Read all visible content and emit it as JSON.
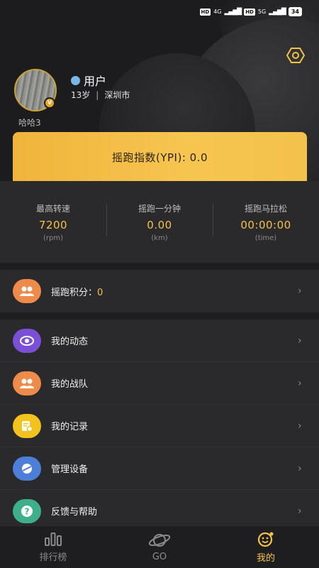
{
  "status_bar": {
    "net1_tag": "HD",
    "net1": "4G",
    "net2_tag": "HD",
    "net2": "5G",
    "battery": "34"
  },
  "profile": {
    "name": "用户",
    "age": "13岁",
    "city": "深圳市",
    "nickname": "哈哈3"
  },
  "ypi": {
    "label": "摇跑指数(YPI): 0.0"
  },
  "stats": [
    {
      "label": "最高转速",
      "value": "7200",
      "unit": "(rpm)"
    },
    {
      "label": "摇跑一分钟",
      "value": "0.00",
      "unit": "(km)"
    },
    {
      "label": "摇跑马拉松",
      "value": "00:00:00",
      "unit": "(time)"
    }
  ],
  "score": {
    "label": "摇跑积分：",
    "value": "0",
    "icon": "team-icon"
  },
  "menu": [
    {
      "label": "我的动态",
      "icon": "eye-icon",
      "color": "#7b4fd6"
    },
    {
      "label": "我的战队",
      "icon": "team-icon",
      "color": "#ee8a4a"
    },
    {
      "label": "我的记录",
      "icon": "record-icon",
      "color": "#f2c21e"
    },
    {
      "label": "管理设备",
      "icon": "device-icon",
      "color": "#4d7fd9"
    },
    {
      "label": "反馈与帮助",
      "icon": "help-icon",
      "color": "#3fae8a"
    }
  ],
  "tabs": [
    {
      "label": "排行榜",
      "icon": "ranking-icon"
    },
    {
      "label": "GO",
      "icon": "go-icon"
    },
    {
      "label": "我的",
      "icon": "mine-icon"
    }
  ],
  "colors": {
    "accent": "#f3c24a",
    "background": "#1e1e20",
    "card": "#2a2a2c"
  }
}
